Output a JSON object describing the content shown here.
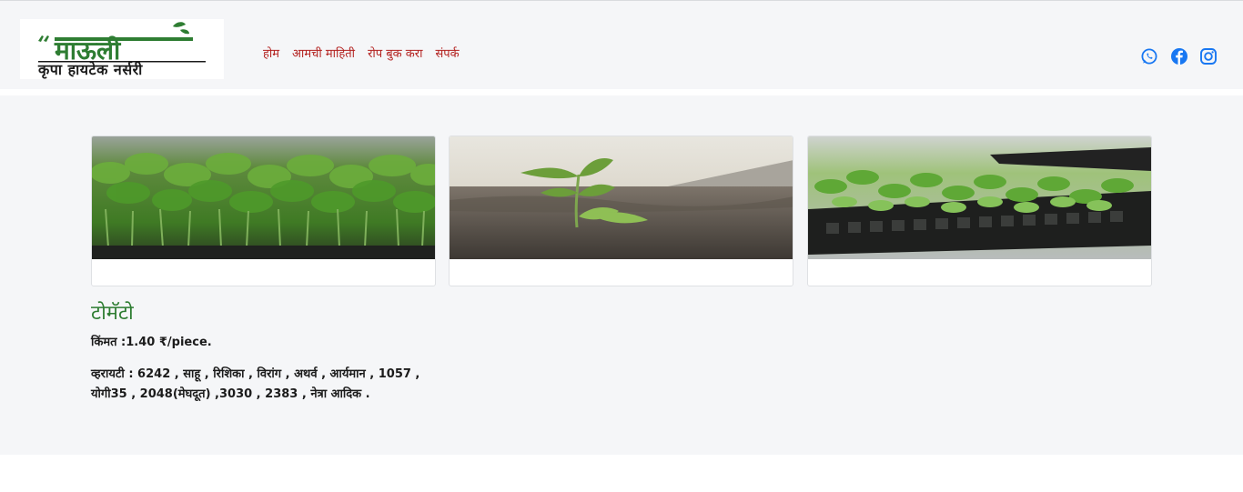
{
  "brand": {
    "name": "माऊली",
    "tagline": "कृपा हायटेक नर्सरी"
  },
  "nav": [
    "होम",
    "आमची माहिती",
    "रोप बुक करा",
    "संपर्क"
  ],
  "social": [
    {
      "icon": "whatsapp-icon",
      "color": "#1877f2"
    },
    {
      "icon": "facebook-icon",
      "color": "#1877f2"
    },
    {
      "icon": "instagram-icon",
      "color": "#1877f2"
    }
  ],
  "gallery": [
    {
      "name": "tomato-seedlings-tray-image"
    },
    {
      "name": "tomato-seedling-in-soil-image"
    },
    {
      "name": "seedling-pro-tray-image"
    }
  ],
  "product": {
    "title": "टोमॅटो",
    "price": "किंमत :1.40 ₹/piece.",
    "varieties": "व्हरायटी : 6242 , साहू , रिशिका , विरांग , अथर्व , आर्यमान , 1057 , योगी35 , 2048(मेघदूत) ,3030 , 2383 , नेत्रा आदिक ."
  },
  "colors": {
    "nav": "#b3211f",
    "title": "#2e7d32",
    "brand_green": "#2e7d32",
    "icons": "#1877f2"
  }
}
